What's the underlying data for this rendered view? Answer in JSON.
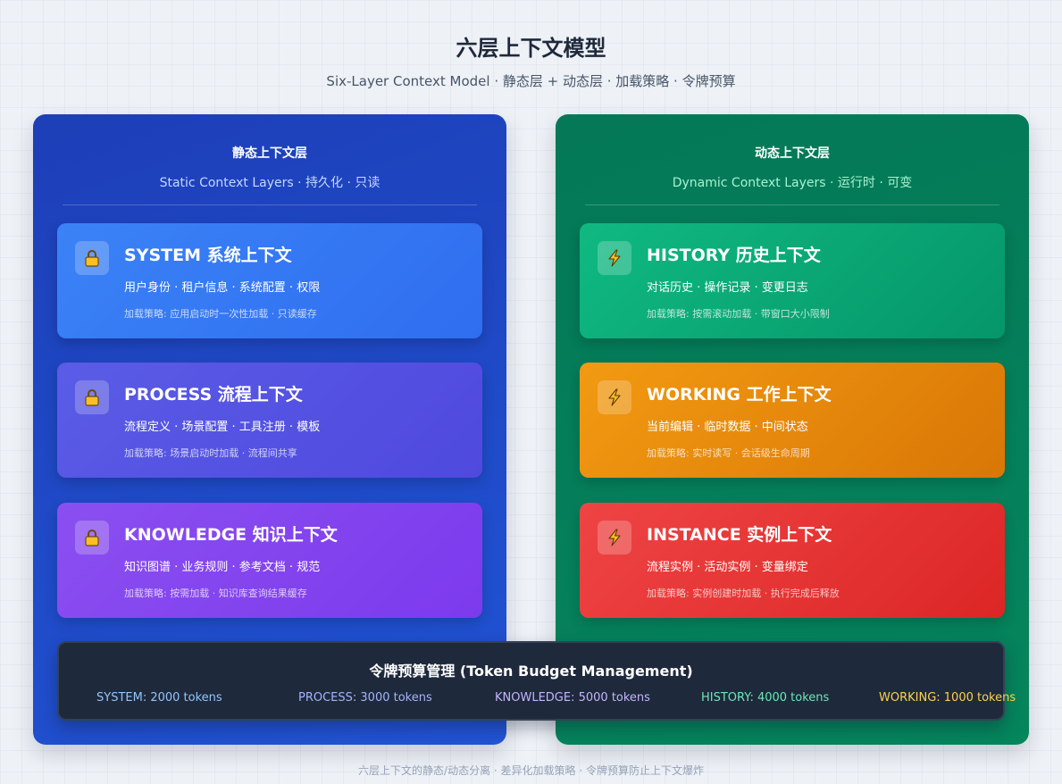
{
  "header": {
    "title": "六层上下文模型",
    "subtitle": "Six-Layer Context Model · 静态层 + 动态层 · 加载策略 · 令牌预算"
  },
  "static_panel": {
    "title": "静态上下文层",
    "subtitle": "Static Context Layers · 持久化 · 只读",
    "color": "#1d4ed8",
    "cards": [
      {
        "title": "SYSTEM 系统上下文",
        "items": "用户身份 · 租户信息 · 系统配置 · 权限",
        "strategy": "加载策略: 应用启动时一次性加载 · 只读缓存",
        "icon": "lock-icon",
        "color": "#3b82f6"
      },
      {
        "title": "PROCESS 流程上下文",
        "items": "流程定义 · 场景配置 · 工具注册 · 模板",
        "strategy": "加载策略: 场景启动时加载 · 流程间共享",
        "icon": "lock-icon",
        "color": "#4f46e5"
      },
      {
        "title": "KNOWLEDGE 知识上下文",
        "items": "知识图谱 · 业务规则 · 参考文档 · 规范",
        "strategy": "加载策略: 按需加载 · 知识库查询结果缓存",
        "icon": "lock-icon",
        "color": "#7c3aed"
      }
    ]
  },
  "dynamic_panel": {
    "title": "动态上下文层",
    "subtitle": "Dynamic Context Layers · 运行时 · 可变",
    "color": "#047857",
    "cards": [
      {
        "title": "HISTORY 历史上下文",
        "items": "对话历史 · 操作记录 · 变更日志",
        "strategy": "加载策略: 按需滚动加载 · 带窗口大小限制",
        "icon": "lightning-icon",
        "color": "#10b981"
      },
      {
        "title": "WORKING 工作上下文",
        "items": "当前编辑 · 临时数据 · 中间状态",
        "strategy": "加载策略: 实时读写 · 会话级生命周期",
        "icon": "lightning-icon",
        "color": "#f59e0b"
      },
      {
        "title": "INSTANCE 实例上下文",
        "items": "流程实例 · 活动实例 · 变量绑定",
        "strategy": "加载策略: 实例创建时加载 · 执行完成后释放",
        "icon": "lightning-icon",
        "color": "#ef4444"
      }
    ]
  },
  "budget": {
    "title": "令牌预算管理 (Token Budget Management)",
    "items": [
      {
        "label": "SYSTEM: 2000 tokens",
        "color": "#93c5fd"
      },
      {
        "label": "PROCESS: 3000 tokens",
        "color": "#a5b4fc"
      },
      {
        "label": "KNOWLEDGE: 5000 tokens",
        "color": "#c4b5fd"
      },
      {
        "label": "HISTORY: 4000 tokens",
        "color": "#6ee7b7"
      },
      {
        "label": "WORKING: 1000 tokens",
        "color": "#fcd34d"
      }
    ]
  },
  "footer": {
    "text": "六层上下文的静态/动态分离 · 差异化加载策略 · 令牌预算防止上下文爆炸"
  }
}
